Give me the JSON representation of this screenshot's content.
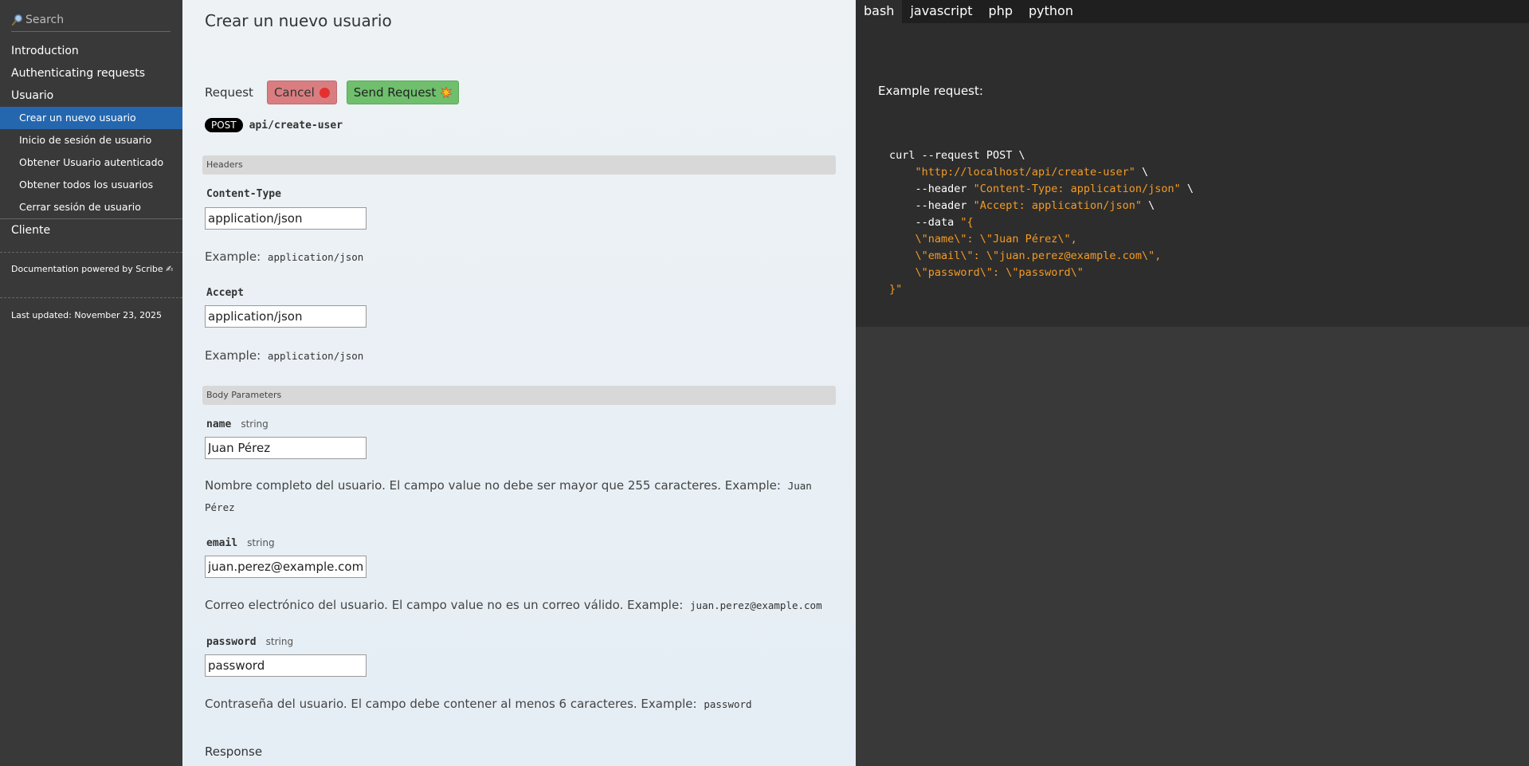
{
  "sidebar": {
    "search_placeholder": "Search",
    "items": [
      {
        "label": "Introduction"
      },
      {
        "label": "Authenticating requests"
      },
      {
        "label": "Usuario"
      }
    ],
    "sub_items": [
      {
        "label": "Crear un nuevo usuario",
        "active": true
      },
      {
        "label": "Inicio de sesión de usuario"
      },
      {
        "label": "Obtener Usuario autenticado"
      },
      {
        "label": "Obtener todos los usuarios"
      },
      {
        "label": "Cerrar sesión de usuario"
      }
    ],
    "after_item": "Cliente",
    "powered_by": "Documentation powered by Scribe ✍",
    "last_updated": "Last updated: November 23, 2025"
  },
  "main": {
    "title": "Crear un nuevo usuario",
    "request_label": "Request",
    "cancel_label": "Cancel",
    "send_label": "Send Request",
    "method": "POST",
    "path": "api/create-user",
    "headers_section": "Headers",
    "headers": [
      {
        "name": "Content-Type",
        "value": "application/json",
        "example_label": "Example:",
        "example": "application/json"
      },
      {
        "name": "Accept",
        "value": "application/json",
        "example_label": "Example:",
        "example": "application/json"
      }
    ],
    "body_section": "Body Parameters",
    "body_params": [
      {
        "name": "name",
        "type": "string",
        "value": "Juan Pérez",
        "description": "Nombre completo del usuario. El campo value no debe ser mayor que 255 caracteres. Example:",
        "example": "Juan Pérez"
      },
      {
        "name": "email",
        "type": "string",
        "value": "juan.perez@example.com",
        "description": "Correo electrónico del usuario. El campo value no es un correo válido. Example:",
        "example": "juan.perez@example.com"
      },
      {
        "name": "password",
        "type": "string",
        "value": "password",
        "description": "Contraseña del usuario. El campo debe contener al menos 6 caracteres. Example:",
        "example": "password"
      }
    ],
    "response_label": "Response"
  },
  "code_panel": {
    "tabs": [
      "bash",
      "javascript",
      "php",
      "python"
    ],
    "active_tab": "bash",
    "example_label": "Example request:",
    "code_lines": [
      {
        "plain": "curl --request POST \\",
        "str": ""
      },
      {
        "plain": "    ",
        "str": "\"http://localhost/api/create-user\"",
        "tail": " \\"
      },
      {
        "plain": "    --header ",
        "str": "\"Content-Type: application/json\"",
        "tail": " \\"
      },
      {
        "plain": "    --header ",
        "str": "\"Accept: application/json\"",
        "tail": " \\"
      },
      {
        "plain": "    --data ",
        "str": "\"{",
        "tail": ""
      },
      {
        "plain": "    ",
        "str": "\\\"name\\\": \\\"Juan Pérez\\\",",
        "tail": ""
      },
      {
        "plain": "    ",
        "str": "\\\"email\\\": \\\"juan.perez@example.com\\\",",
        "tail": ""
      },
      {
        "plain": "    ",
        "str": "\\\"password\\\": \\\"password\\\"",
        "tail": ""
      },
      {
        "plain": "",
        "str": "}\"",
        "tail": ""
      }
    ]
  },
  "colors": {
    "sidebar_bg": "#393939",
    "active_nav": "#2467af",
    "code_string": "#f39b26",
    "cancel_btn": "#d97d81",
    "send_btn": "#6fbf6d"
  }
}
